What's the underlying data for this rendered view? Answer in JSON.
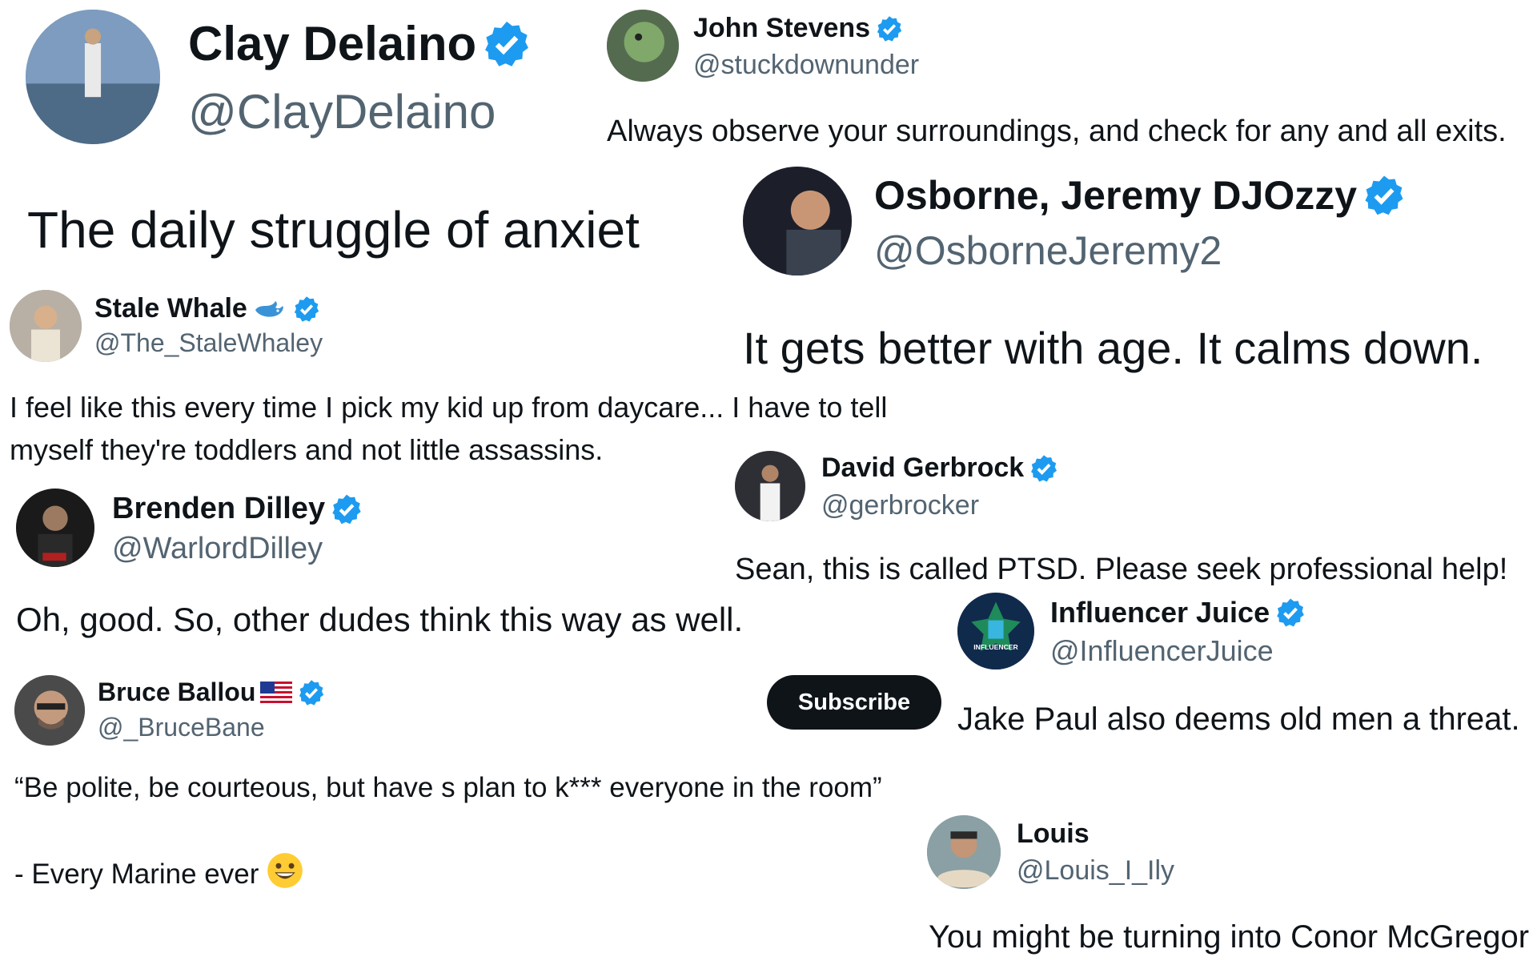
{
  "accent": "#1d9bf0",
  "cards": {
    "clay": {
      "name": "Clay Delaino",
      "handle": "@ClayDelaino",
      "text": "The daily struggle of anxiet"
    },
    "john": {
      "name": "John Stevens",
      "handle": "@stuckdownunder",
      "text": "Always observe your surroundings, and check for any and all exits."
    },
    "osborne": {
      "name": "Osborne, Jeremy DJOzzy",
      "handle": "@OsborneJeremy2",
      "text": "It gets better with age. It calms down."
    },
    "stale": {
      "name": "Stale Whale",
      "handle": "@The_StaleWhaley",
      "text_line1": "I feel like this every time I pick my kid up from daycare... I have to tell",
      "text_line2": "myself they're toddlers and not little assassins.",
      "emoji": "whale-icon"
    },
    "david": {
      "name": "David Gerbrock",
      "handle": "@gerbrocker",
      "text": "Sean, this is called PTSD. Please seek professional help!"
    },
    "brenden": {
      "name": "Brenden Dilley",
      "handle": "@WarlordDilley",
      "text": "Oh, good. So, other dudes think this way as well."
    },
    "influencer": {
      "name": "Influencer Juice",
      "handle": "@InfluencerJuice",
      "text": "Jake Paul also deems old men a threat.",
      "avatar_text": "INFLUENCER"
    },
    "bruce": {
      "name": "Bruce Ballou",
      "handle": "@_BruceBane",
      "text_line1": "“Be polite, be courteous, but have s plan to k*** everyone in the room”",
      "text_line2": "- Every Marine ever",
      "flag": "us-flag-icon"
    },
    "louis": {
      "name": "Louis",
      "handle": "@Louis_I_Ily",
      "text": "You might be turning into Conor McGregor"
    }
  },
  "subscribe_label": "Subscribe"
}
